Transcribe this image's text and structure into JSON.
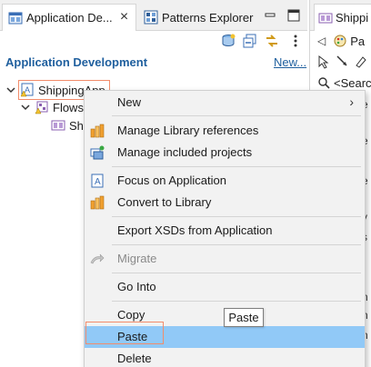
{
  "left_view": {
    "tabs": [
      {
        "label": "Application De...",
        "active": true
      },
      {
        "label": "Patterns Explorer",
        "active": false
      }
    ],
    "title": "Application Development",
    "new_link": "New...",
    "tree": [
      {
        "label": "ShippingApp",
        "level": 0,
        "expanded": true,
        "selected": true
      },
      {
        "label": "Flows",
        "level": 1,
        "expanded": true
      },
      {
        "label": "Sh",
        "level": 2
      }
    ]
  },
  "right_view": {
    "tab_label": "Shippi",
    "toolbar_label": "Pa",
    "search_placeholder": "<Searc",
    "list_fragments": [
      "e",
      "e",
      "e",
      "y",
      "s",
      "r",
      "n",
      "n",
      "n",
      "r",
      "r",
      "r"
    ]
  },
  "context_menu": {
    "items": [
      {
        "label": "New",
        "icon": "none",
        "enabled": true,
        "submenu": true
      },
      {
        "label": "Manage Library references",
        "icon": "library-icon",
        "enabled": true
      },
      {
        "label": "Manage included projects",
        "icon": "projects-icon",
        "enabled": true
      },
      {
        "label": "Focus on Application",
        "icon": "application-icon",
        "enabled": true
      },
      {
        "label": "Convert to Library",
        "icon": "library-icon",
        "enabled": true
      },
      {
        "label": "Export XSDs from Application",
        "icon": "none",
        "enabled": true
      },
      {
        "label": "Migrate",
        "icon": "migrate-icon",
        "enabled": false
      },
      {
        "label": "Go Into",
        "icon": "none",
        "enabled": true
      },
      {
        "label": "Copy",
        "icon": "none",
        "enabled": true
      },
      {
        "label": "Paste",
        "icon": "none",
        "enabled": true,
        "highlighted": true
      },
      {
        "label": "Delete",
        "icon": "none",
        "enabled": true
      }
    ],
    "highlight_color": "#91c9f7"
  },
  "tooltip": "Paste",
  "colors": {
    "accent_blue": "#1f5f9e",
    "selection_outline": "#f28c6b",
    "menu_bg": "#f2f2f2"
  }
}
